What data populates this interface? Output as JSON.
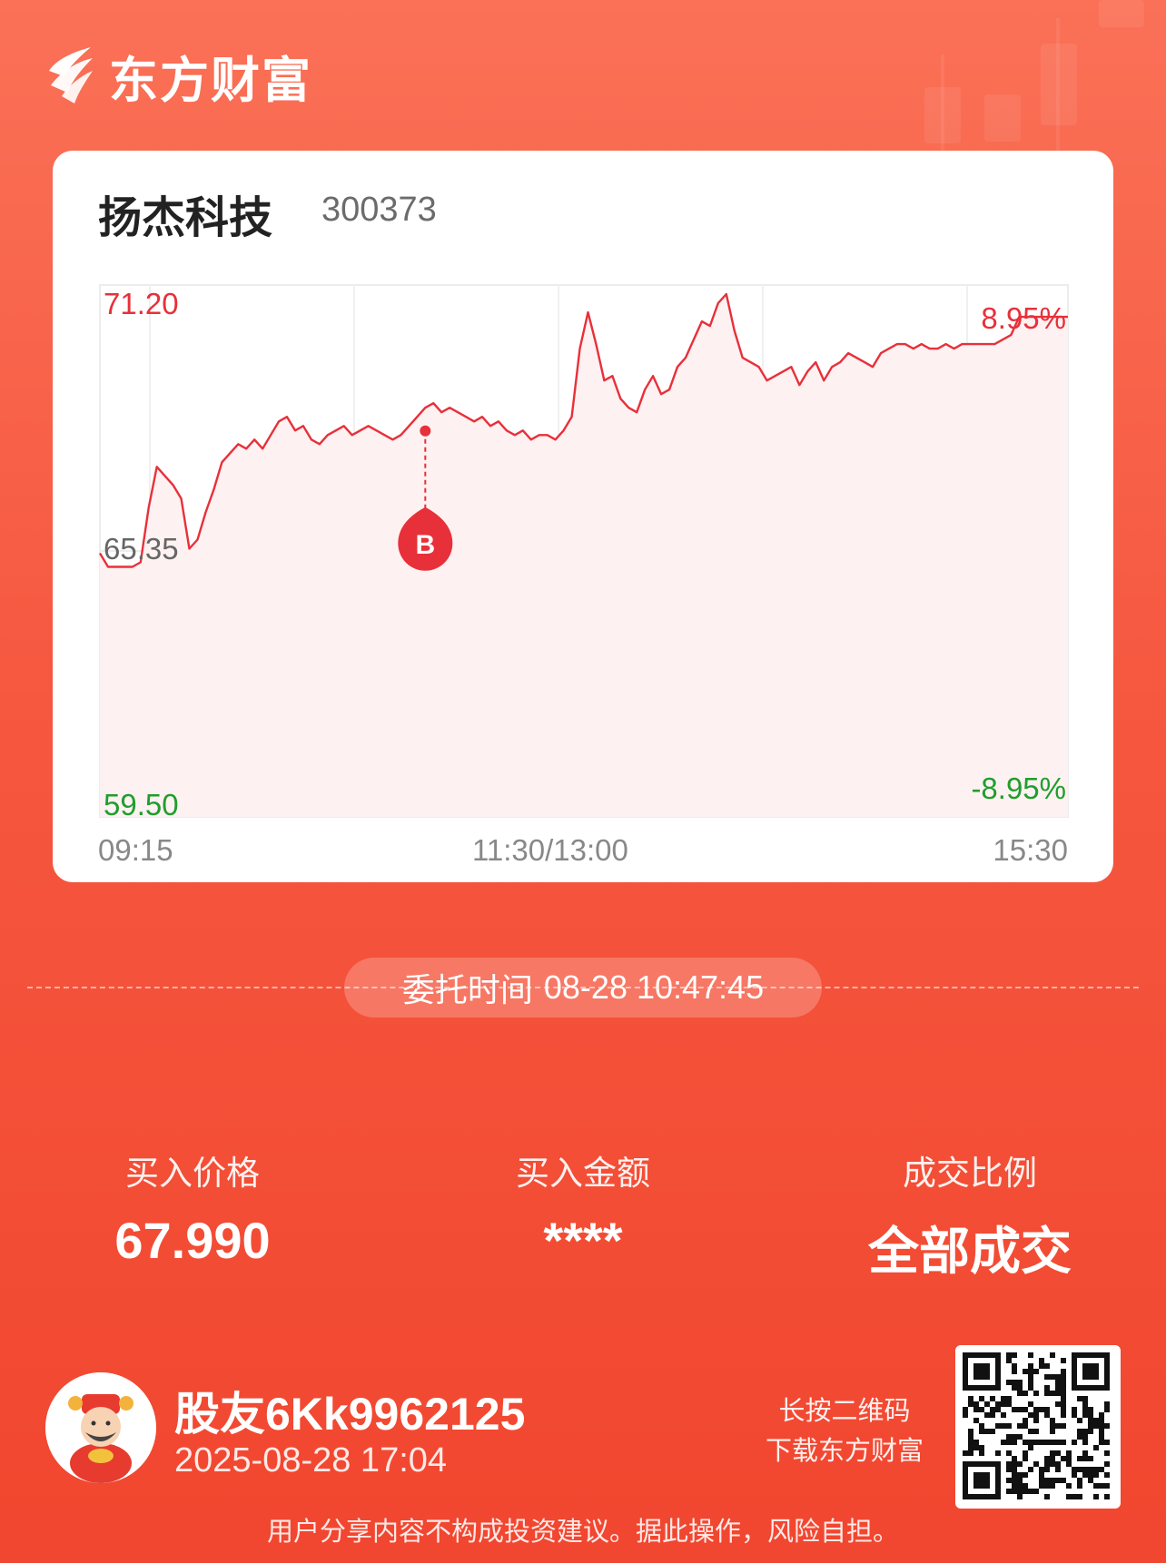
{
  "brand": {
    "name": "东方财富",
    "logo_icon": "eastmoney-logo-icon"
  },
  "stock": {
    "name": "扬杰科技",
    "code": "300373"
  },
  "chart_data": {
    "type": "line",
    "title": "",
    "x_ticks": [
      "09:15",
      "11:30/13:00",
      "15:30"
    ],
    "price_ticks": {
      "high": "71.20",
      "mid": "65.35",
      "low": "59.50"
    },
    "pct_ticks": {
      "high": "8.95%",
      "low": "-8.95%"
    },
    "ylim": [
      59.5,
      71.2
    ],
    "prev_close": 65.35,
    "grid": true,
    "colors": {
      "line": "#e8303a",
      "up_label": "#e8303a",
      "down_label": "#1f9e2c",
      "fill": "#fdf1f1"
    },
    "series": [
      {
        "values": [
          65.3,
          65.0,
          65.0,
          65.0,
          65.0,
          65.1,
          66.3,
          67.2,
          67.0,
          66.8,
          66.5,
          65.4,
          65.6,
          66.2,
          66.7,
          67.3,
          67.5,
          67.7,
          67.6,
          67.8,
          67.6,
          67.9,
          68.2,
          68.3,
          68.0,
          68.1,
          67.8,
          67.7,
          67.9,
          68.0,
          68.1,
          67.9,
          68.0,
          68.1,
          68.0,
          67.9,
          67.8,
          67.9,
          68.1,
          68.3,
          68.5,
          68.6,
          68.4,
          68.5,
          68.4,
          68.3,
          68.2,
          68.3,
          68.1,
          68.2,
          68.0,
          67.9,
          68.0,
          67.8,
          67.9,
          67.9,
          67.8,
          68.0,
          68.3,
          69.8,
          70.6,
          69.9,
          69.1,
          69.2,
          68.7,
          68.5,
          68.4,
          68.9,
          69.2,
          68.8,
          68.9,
          69.4,
          69.6,
          70.0,
          70.4,
          70.3,
          70.8,
          71.0,
          70.2,
          69.6,
          69.5,
          69.4,
          69.1,
          69.2,
          69.3,
          69.4,
          69.0,
          69.3,
          69.5,
          69.1,
          69.4,
          69.5,
          69.7,
          69.6,
          69.5,
          69.4,
          69.7,
          69.8,
          69.9,
          69.9,
          69.8,
          69.9,
          69.8,
          69.8,
          69.9,
          69.8,
          69.9,
          69.9,
          69.9,
          69.9,
          69.9,
          70.0,
          70.1,
          70.5,
          70.5,
          70.5,
          70.5,
          70.5,
          70.5,
          70.5
        ]
      }
    ],
    "marker": {
      "label": "B",
      "index": 40,
      "value": 67.99
    }
  },
  "order": {
    "label": "委托时间",
    "time": "08-28 10:47:45"
  },
  "stats": [
    {
      "label": "买入价格",
      "value": "67.990"
    },
    {
      "label": "买入金额",
      "value": "****"
    },
    {
      "label": "成交比例",
      "value": "全部成交"
    }
  ],
  "user": {
    "name": "股友6Kk9962125",
    "time": "2025-08-28 17:04",
    "avatar_icon": "fortune-god-avatar-icon"
  },
  "qr": {
    "hint_line1": "长按二维码",
    "hint_line2": "下载东方财富",
    "icon": "qr-code-icon"
  },
  "disclaimer": "用户分享内容不构成投资建议。据此操作，风险自担。"
}
